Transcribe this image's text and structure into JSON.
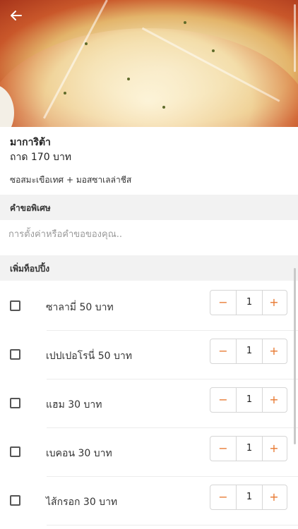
{
  "header": {
    "back_icon": "arrow-left-icon",
    "hero_image": "pizza-photo"
  },
  "item": {
    "name": "มาการิต้า",
    "price": "ถาด 170 บาท",
    "description": "ซอสมะเขือเทศ + มอสซาเลล่าชีส"
  },
  "special_request": {
    "heading": "คำขอพิเศษ",
    "placeholder": "การตั้งค่าหรือคำขอของคุณ.."
  },
  "toppings": {
    "heading": "เพิ่มท็อปปิ้ง",
    "items": [
      {
        "label": "ซาลามี่ 50 บาท",
        "qty": "1",
        "checked": false
      },
      {
        "label": "เปปเปอโรนี่ 50 บาท",
        "qty": "1",
        "checked": false
      },
      {
        "label": "แฮม 30 บาท",
        "qty": "1",
        "checked": false
      },
      {
        "label": "เบคอน 30 บาท",
        "qty": "1",
        "checked": false
      },
      {
        "label": "ไส้กรอก 30 บาท",
        "qty": "1",
        "checked": false
      }
    ],
    "minus": "−",
    "plus": "+"
  },
  "colors": {
    "accent": "#e8772e",
    "section_bg": "#f2f2f2"
  }
}
